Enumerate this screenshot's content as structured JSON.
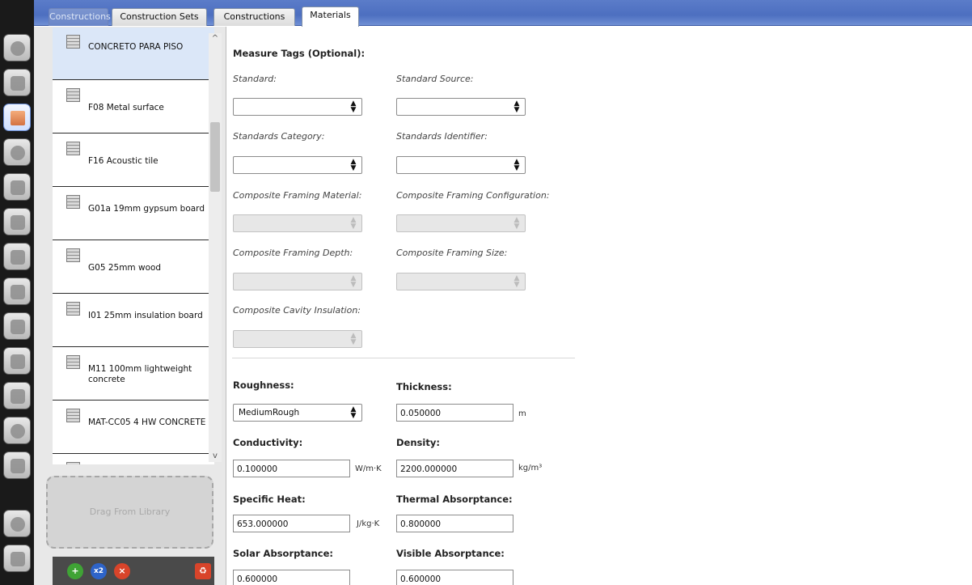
{
  "tabs": {
    "constructions_faded": "Constructions",
    "construction_sets": "Construction Sets",
    "constructions": "Constructions",
    "materials": "Materials"
  },
  "library": {
    "items": [
      {
        "label": "CONCRETO PARA PISO"
      },
      {
        "label": "F08 Metal surface"
      },
      {
        "label": "F16 Acoustic tile"
      },
      {
        "label": "G01a 19mm gypsum board"
      },
      {
        "label": "G05 25mm wood"
      },
      {
        "label": "I01 25mm insulation board"
      },
      {
        "label": "M11 100mm lightweight concrete"
      },
      {
        "label": "MAT-CC05 4 HW CONCRETE"
      }
    ],
    "drop_text": "Drag From Library",
    "copy_label": "x2"
  },
  "measure_tags": {
    "title": "Measure Tags (Optional):",
    "standard": "Standard:",
    "standard_source": "Standard Source:",
    "standards_category": "Standards Category:",
    "standards_identifier": "Standards Identifier:",
    "framing_material": "Composite Framing Material:",
    "framing_configuration": "Composite Framing Configuration:",
    "framing_depth": "Composite Framing Depth:",
    "framing_size": "Composite Framing Size:",
    "cavity_insulation": "Composite Cavity Insulation:"
  },
  "properties": {
    "roughness_label": "Roughness:",
    "roughness_value": "MediumRough",
    "thickness_label": "Thickness:",
    "thickness_value": "0.050000",
    "thickness_unit": "m",
    "conductivity_label": "Conductivity:",
    "conductivity_value": "0.100000",
    "conductivity_unit": "W/m·K",
    "density_label": "Density:",
    "density_value": "2200.000000",
    "density_unit": "kg/m³",
    "specific_heat_label": "Specific Heat:",
    "specific_heat_value": "653.000000",
    "specific_heat_unit": "J/kg·K",
    "thermal_absorptance_label": "Thermal Absorptance:",
    "thermal_absorptance_value": "0.800000",
    "solar_absorptance_label": "Solar Absorptance:",
    "solar_absorptance_value": "0.600000",
    "visible_absorptance_label": "Visible Absorptance:",
    "visible_absorptance_value": "0.600000"
  },
  "colors": {
    "tab_strip": "#4d6fc0",
    "selected_item": "#dbe7f8",
    "add_button": "#3fa335",
    "remove_button": "#d9442a"
  }
}
